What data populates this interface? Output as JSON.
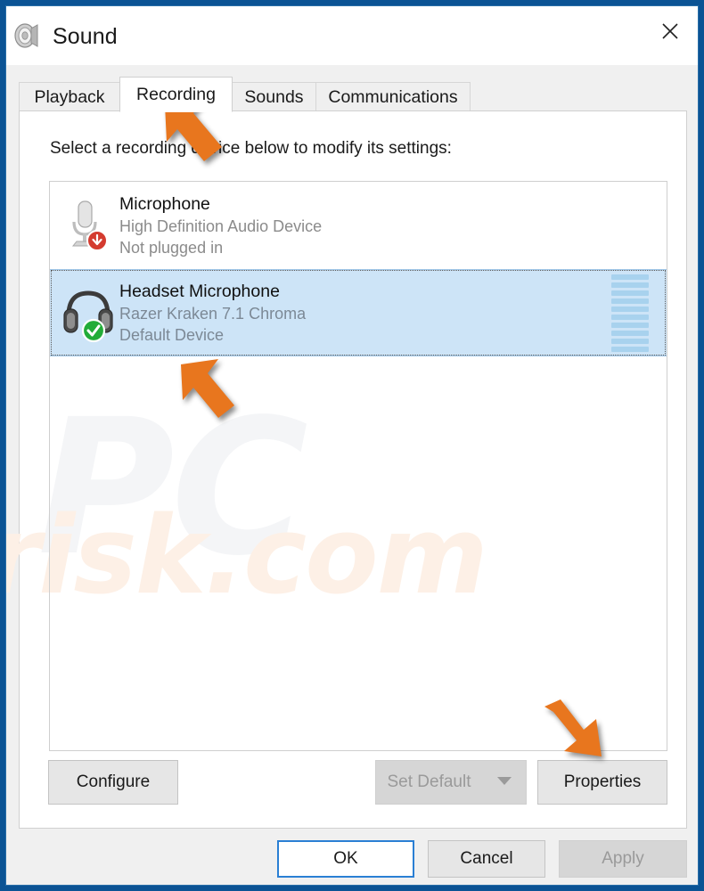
{
  "window": {
    "title": "Sound",
    "icon": "speaker-icon",
    "close_label": "✕",
    "frame_color": "#0b5394",
    "body_color": "#f0f0f0"
  },
  "tabs": [
    {
      "label": "Playback",
      "active": false
    },
    {
      "label": "Recording",
      "active": true
    },
    {
      "label": "Sounds",
      "active": false
    },
    {
      "label": "Communications",
      "active": false
    }
  ],
  "main": {
    "instruction": "Select a recording device below to modify its settings:",
    "watermark_primary": "PC",
    "watermark_secondary": "risk.com"
  },
  "devices": [
    {
      "name": "Microphone",
      "description": "High Definition Audio Device",
      "status": "Not plugged in",
      "icon": "desk-microphone-icon",
      "badge": "red-down-arrow-badge",
      "selected": false,
      "has_meter": false
    },
    {
      "name": "Headset Microphone",
      "description": "Razer Kraken 7.1 Chroma",
      "status": "Default Device",
      "icon": "headset-icon",
      "badge": "green-check-badge",
      "selected": true,
      "has_meter": true,
      "meter_segments": 10,
      "meter_color": "#a8d2ee"
    }
  ],
  "buttons": {
    "configure": {
      "label": "Configure",
      "enabled": true
    },
    "set_default": {
      "label": "Set Default",
      "enabled": false,
      "has_dropdown": true
    },
    "properties": {
      "label": "Properties",
      "enabled": true
    },
    "ok": {
      "label": "OK",
      "enabled": true,
      "focused": true
    },
    "cancel": {
      "label": "Cancel",
      "enabled": true
    },
    "apply": {
      "label": "Apply",
      "enabled": false
    }
  },
  "annotations": {
    "arrow_color": "#e8761e",
    "arrows": [
      {
        "name": "arrow-to-recording-tab",
        "direction": "up-left"
      },
      {
        "name": "arrow-to-headset-device",
        "direction": "up-left"
      },
      {
        "name": "arrow-to-properties-button",
        "direction": "down-right"
      }
    ]
  }
}
